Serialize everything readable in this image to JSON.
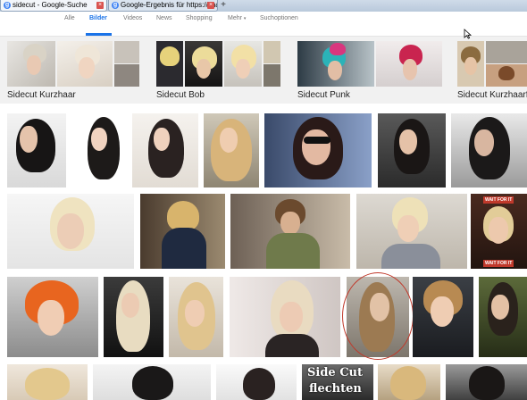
{
  "browser": {
    "tabs": [
      {
        "title": "sidecut - Google-Suche",
        "favicon": "g-icon",
        "active": true
      },
      {
        "title": "Google-Ergebnis für https://image...",
        "favicon": "g-icon",
        "active": false
      }
    ],
    "new_tab_label": "+",
    "close_glyph": "×"
  },
  "nav": {
    "items": [
      {
        "label": "Alle",
        "active": false
      },
      {
        "label": "Bilder",
        "active": true
      },
      {
        "label": "Videos",
        "active": false
      },
      {
        "label": "News",
        "active": false
      },
      {
        "label": "Shopping",
        "active": false
      },
      {
        "label": "Mehr",
        "active": false,
        "has_caret": true
      },
      {
        "label": "Suchoptionen",
        "active": false
      }
    ],
    "caret_glyph": "▾",
    "accent_color": "#1a73e8"
  },
  "related": [
    {
      "label": "Sidecut Kurzhaar"
    },
    {
      "label": "Sidecut Bob"
    },
    {
      "label": "Sidecut Punk"
    },
    {
      "label": "Sidecut Kurzhaarf"
    }
  ],
  "thumb_texts": {
    "wait_top": "WAIT FOR IT",
    "wait_bottom": "WAIT FOR IT",
    "side_cut_line1": "Side Cut",
    "side_cut_line2": "flechten"
  },
  "colors": {
    "highlight_ring": "#c0392b",
    "related_bg": "#f1f1f1"
  }
}
